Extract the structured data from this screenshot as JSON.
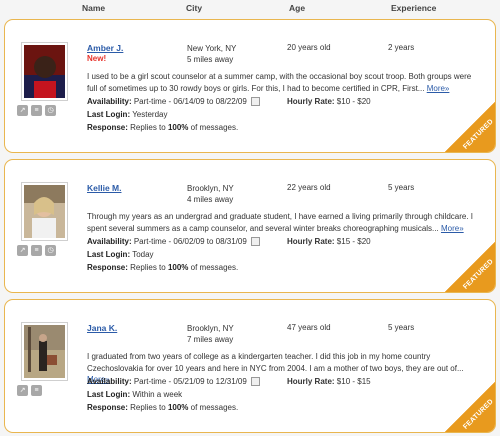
{
  "columns": {
    "name": "Name",
    "city": "City",
    "age": "Age",
    "experience": "Experience"
  },
  "labels": {
    "availability": "Availability:",
    "hourly_rate": "Hourly Rate:",
    "last_login": "Last Login:",
    "response": "Response:",
    "featured": "FEATURED",
    "new": "New!"
  },
  "listings": [
    {
      "name": "Amber J.",
      "is_new": true,
      "city": "New York, NY",
      "distance": "5 miles away",
      "age": "20 years old",
      "experience": "2 years",
      "description": "I used to be a girl scout counselor at a summer camp, with the occasional boy scout troop. Both groups were full of sometimes up to 30 rowdy boys or girls. For this, I had to become certified in CPR, First...",
      "more": "More»",
      "availability": "Part-time - 06/14/09 to 08/22/09",
      "rate": "$10 - $20",
      "last_login": "Yesterday",
      "response_prefix": "Replies to ",
      "response_pct": "100%",
      "response_suffix": " of messages."
    },
    {
      "name": "Kellie M.",
      "is_new": false,
      "city": "Brooklyn, NY",
      "distance": "4 miles away",
      "age": "22 years old",
      "experience": "5 years",
      "description": "Through my years as an undergrad and graduate student, I have earned a living primarily through childcare. I spent several summers as a camp counselor, and several winter breaks choreographing musicals...",
      "more": "More»",
      "availability": "Part-time - 06/02/09 to 08/31/09",
      "rate": "$15 - $20",
      "last_login": "Today",
      "response_prefix": "Replies to ",
      "response_pct": "100%",
      "response_suffix": " of messages."
    },
    {
      "name": "Jana K.",
      "is_new": false,
      "city": "Brooklyn, NY",
      "distance": "7 miles away",
      "age": "47 years old",
      "experience": "5 years",
      "description": "I graduated from two years of college as a kindergarten teacher. I did this job in my home country Czechoslovakia for over 10 years and here in NYC from 2004. I am a mother of two boys, they are out of...",
      "more": "More»",
      "availability": "Part-time - 05/21/09 to 12/31/09",
      "rate": "$10 - $15",
      "last_login": "Within a week",
      "response_prefix": "Replies to ",
      "response_pct": "100%",
      "response_suffix": " of messages."
    }
  ],
  "colors": {
    "accent_border": "#e9b64f",
    "link": "#2b5ba8",
    "featured": "#e89a1e",
    "new": "#e8322a"
  },
  "icons": [
    "share-icon",
    "notes-icon",
    "clock-icon"
  ]
}
